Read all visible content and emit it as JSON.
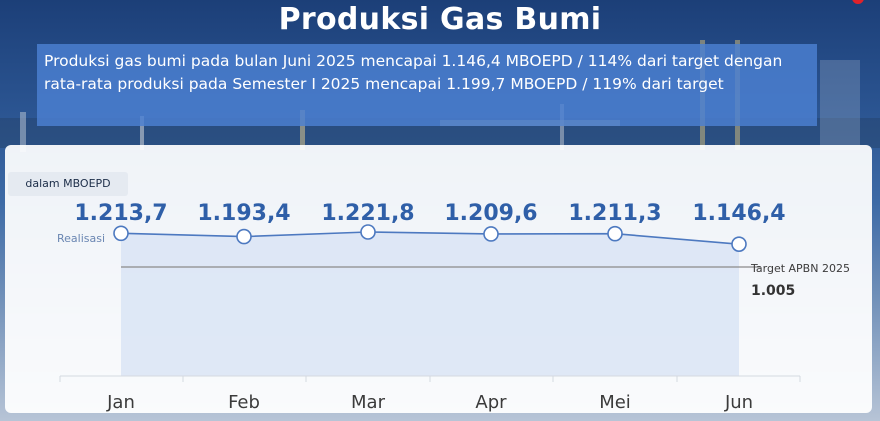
{
  "title": "Produksi Gas Bumi",
  "summary": "Produksi gas bumi pada bulan Juni 2025 mencapai 1.146,4 MBOEPD / 114% dari target dengan rata-rata produksi pada Semester I 2025 mencapai 1.199,7 MBOEPD / 119% dari target",
  "colors": {
    "series": "#4d79c0",
    "area": "#dbe5f5",
    "target_line": "#8a8a8a",
    "value_labels": "#2f5fa8",
    "summary_box": "#4c80d2"
  },
  "chart_data": {
    "type": "line",
    "unit_label": "dalam MBOEPD",
    "categories": [
      "Jan",
      "Feb",
      "Mar",
      "Apr",
      "Mei",
      "Jun"
    ],
    "series": [
      {
        "name": "Realisasi",
        "values": [
          1213.7,
          1193.4,
          1221.8,
          1209.6,
          1211.3,
          1146.4
        ],
        "labels": [
          "1.213,7",
          "1.193,4",
          "1.221,8",
          "1.209,6",
          "1.211,3",
          "1.146,4"
        ]
      }
    ],
    "target": {
      "name": "Target APBN 2025",
      "value": 1005,
      "label": "1.005"
    },
    "grid": false,
    "legend": "none"
  }
}
